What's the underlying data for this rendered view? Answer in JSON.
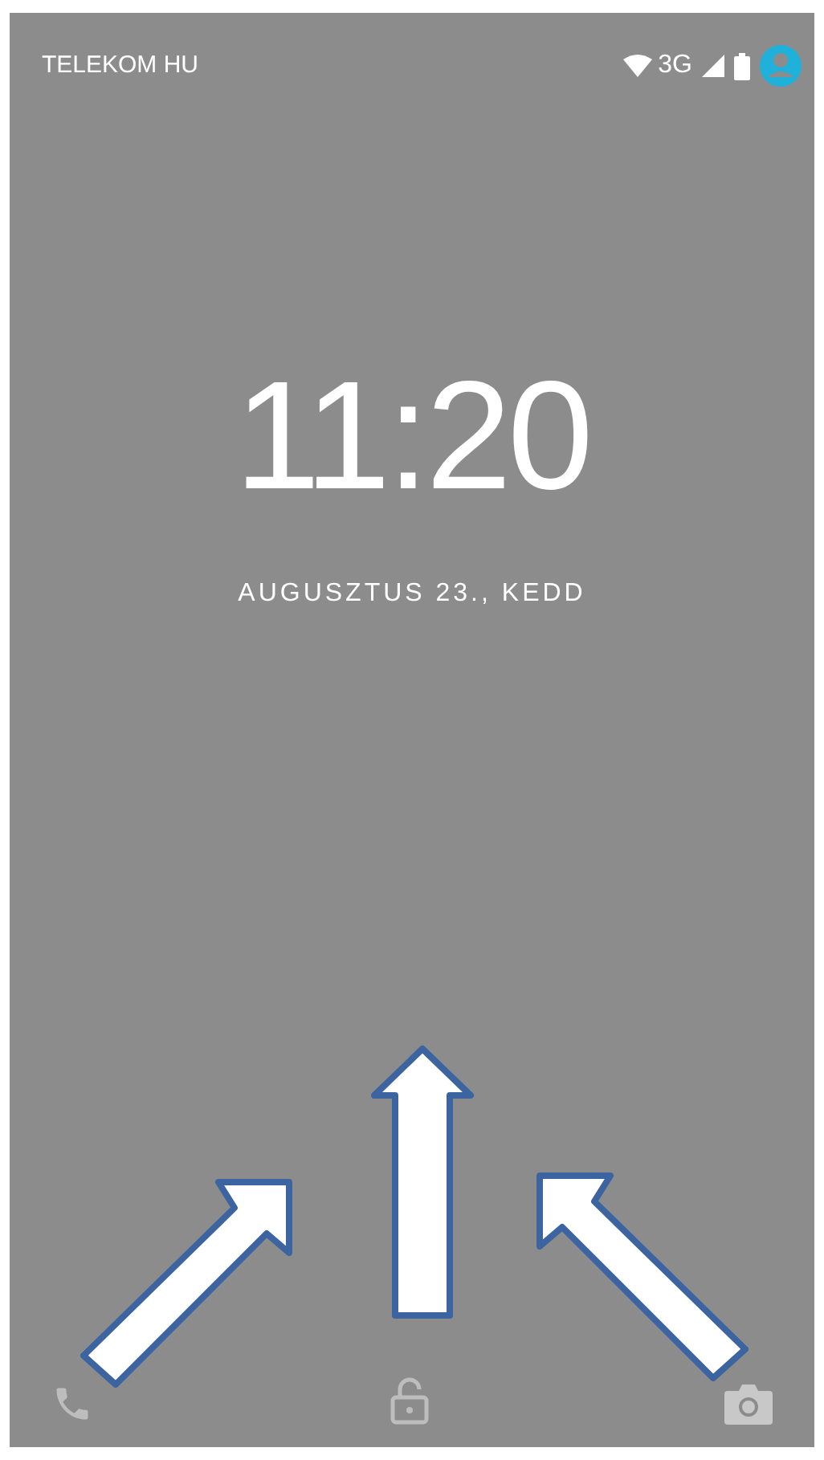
{
  "status_bar": {
    "carrier": "TELEKOM HU",
    "network": "3G"
  },
  "clock": {
    "time": "11:20",
    "date": "AUGUSZTUS 23., KEDD"
  }
}
